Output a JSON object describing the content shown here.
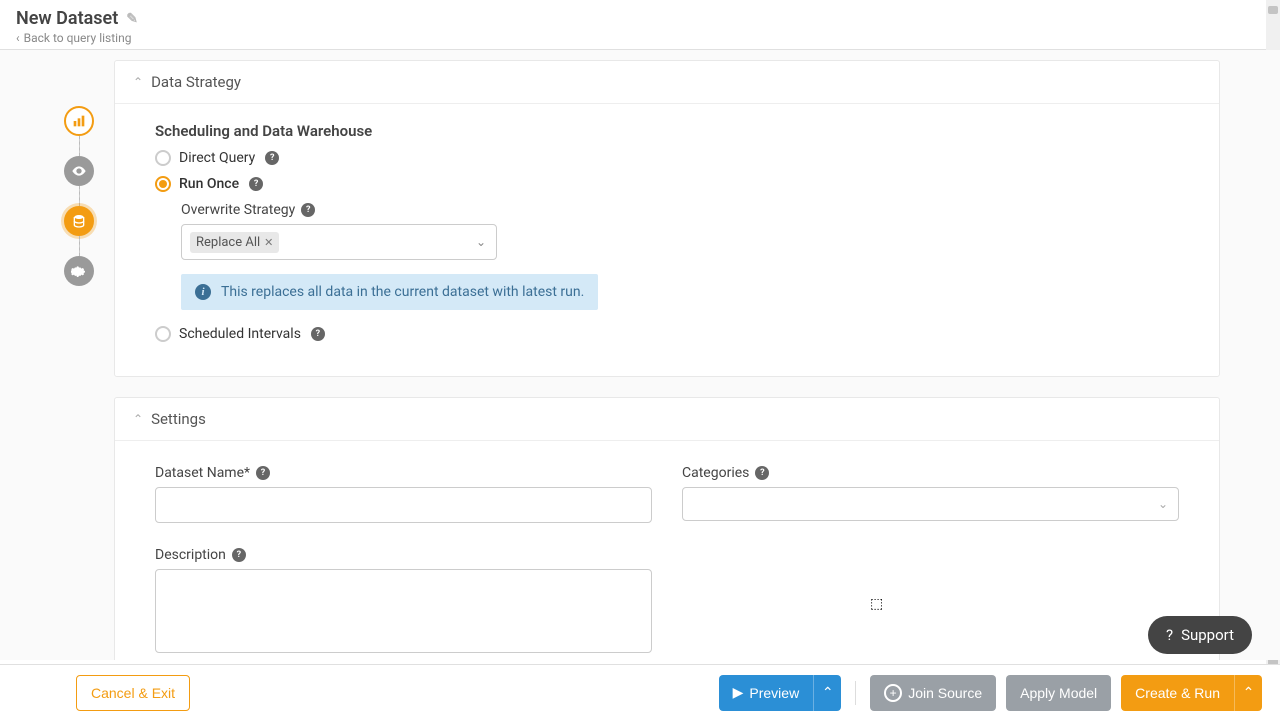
{
  "header": {
    "title": "New Dataset",
    "back_label": "Back to query listing"
  },
  "panels": {
    "data_strategy": {
      "title": "Data Strategy",
      "section_title": "Scheduling and Data Warehouse",
      "options": {
        "direct_query": "Direct Query",
        "run_once": "Run Once",
        "scheduled_intervals": "Scheduled Intervals"
      },
      "overwrite_label": "Overwrite Strategy",
      "overwrite_value": "Replace All",
      "info_text": "This replaces all data in the current dataset with latest run."
    },
    "settings": {
      "title": "Settings",
      "dataset_name_label": "Dataset Name*",
      "categories_label": "Categories",
      "description_label": "Description"
    }
  },
  "footer": {
    "cancel": "Cancel & Exit",
    "preview": "Preview",
    "join_source": "Join Source",
    "apply_model": "Apply Model",
    "create_run": "Create & Run"
  },
  "support_label": "Support"
}
